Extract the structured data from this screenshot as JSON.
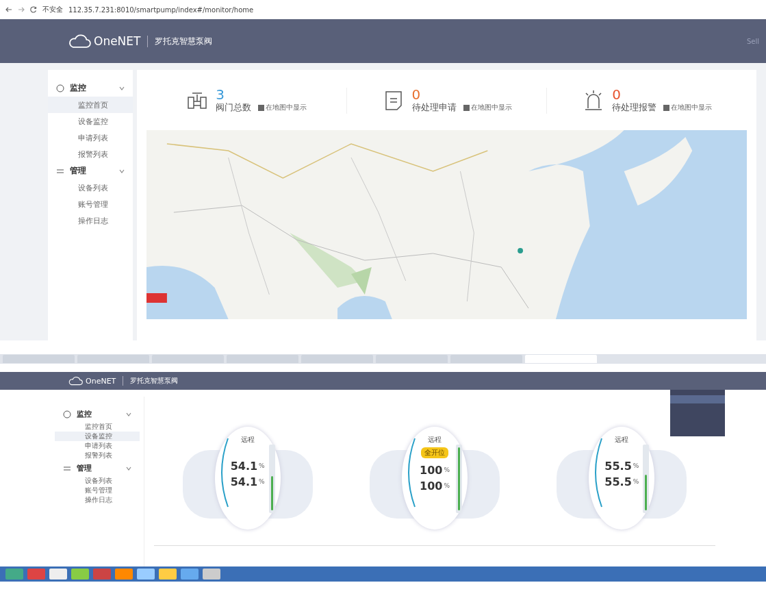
{
  "top_screen": {
    "browser": {
      "security": "不安全",
      "url": "112.35.7.231:8010/smartpump/index#/monitor/home"
    },
    "header": {
      "brand": "OneNET",
      "system": "罗托克智慧泵阀",
      "user": "Sell"
    },
    "sidebar": {
      "groups": [
        {
          "label": "监控",
          "expanded": true,
          "items": [
            {
              "label": "监控首页",
              "selected": true
            },
            {
              "label": "设备监控",
              "selected": false
            },
            {
              "label": "申请列表",
              "selected": false
            },
            {
              "label": "报警列表",
              "selected": false
            }
          ]
        },
        {
          "label": "管理",
          "expanded": true,
          "items": [
            {
              "label": "设备列表",
              "selected": false
            },
            {
              "label": "账号管理",
              "selected": false
            },
            {
              "label": "操作日志",
              "selected": false
            }
          ]
        }
      ]
    },
    "stats": [
      {
        "kind": "valve",
        "value": "3",
        "label": "阀门总数",
        "checkbox_label": "在地图中显示",
        "checked": true,
        "color": "#3a9ad9"
      },
      {
        "kind": "request",
        "value": "0",
        "label": "待处理申请",
        "checkbox_label": "在地图中显示",
        "checked": true,
        "color": "#e8702f"
      },
      {
        "kind": "alarm",
        "value": "0",
        "label": "待处理报警",
        "checkbox_label": "在地图中显示",
        "checked": true,
        "color": "#e8542f"
      }
    ]
  },
  "bottom_screen": {
    "header": {
      "brand": "OneNET",
      "system": "罗托克智慧泵阀"
    },
    "sidebar": {
      "groups": [
        {
          "label": "监控",
          "expanded": true,
          "items": [
            {
              "label": "监控首页",
              "selected": false
            },
            {
              "label": "设备监控",
              "selected": true
            },
            {
              "label": "申请列表",
              "selected": false
            },
            {
              "label": "报警列表",
              "selected": false
            }
          ]
        },
        {
          "label": "管理",
          "expanded": true,
          "items": [
            {
              "label": "设备列表",
              "selected": false
            },
            {
              "label": "账号管理",
              "selected": false
            },
            {
              "label": "操作日志",
              "selected": false
            }
          ]
        }
      ]
    },
    "gauges": [
      {
        "mode": "远程",
        "value": "54.1",
        "unit": "%",
        "setpoint": "54.1",
        "level": 0.541
      },
      {
        "mode": "远程",
        "badge": "全开位",
        "value": "100",
        "unit": "%",
        "setpoint": "100",
        "level": 1
      },
      {
        "mode": "远程",
        "value": "55.5",
        "unit": "%",
        "setpoint": "55.5",
        "level": 0.555
      }
    ]
  }
}
